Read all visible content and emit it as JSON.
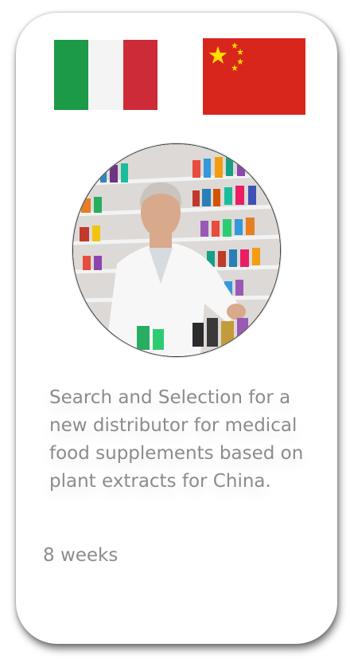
{
  "card": {
    "description": "Search and Selection for a new distributor for medical food supplements based on plant extracts for China.",
    "duration": "8 weeks"
  },
  "icons": {
    "flag_left": "italy-flag",
    "flag_right": "china-flag",
    "photo": "pharmacist-photo"
  },
  "colors": {
    "italy_green": "#1c9a47",
    "italy_white": "#f4f4f4",
    "italy_red": "#cd2b37",
    "china_red": "#d9261c",
    "china_yellow": "#ffde00",
    "text_gray": "#8c8c8c"
  }
}
